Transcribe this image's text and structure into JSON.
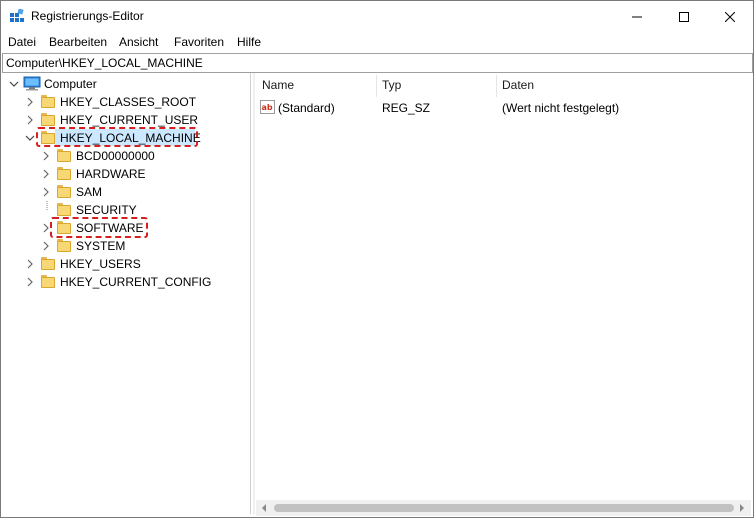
{
  "window": {
    "title": "Registrierungs-Editor",
    "controls": [
      "minimize",
      "maximize",
      "close"
    ]
  },
  "menu": [
    "Datei",
    "Bearbeiten",
    "Ansicht",
    "Favoriten",
    "Hilfe"
  ],
  "address": "Computer\\HKEY_LOCAL_MACHINE",
  "tree": {
    "root": "Computer",
    "hives": [
      "HKEY_CLASSES_ROOT",
      "HKEY_CURRENT_USER",
      "HKEY_LOCAL_MACHINE",
      "HKEY_USERS",
      "HKEY_CURRENT_CONFIG"
    ],
    "hklm_children": [
      "BCD00000000",
      "HARDWARE",
      "SAM",
      "SECURITY",
      "SOFTWARE",
      "SYSTEM"
    ],
    "selected": "HKEY_LOCAL_MACHINE",
    "highlighted": [
      "HKEY_LOCAL_MACHINE",
      "SOFTWARE"
    ]
  },
  "list": {
    "columns": [
      "Name",
      "Typ",
      "Daten"
    ],
    "rows": [
      {
        "name": "(Standard)",
        "type": "REG_SZ",
        "data": "(Wert nicht festgelegt)"
      }
    ]
  },
  "colors": {
    "selection": "#cce8ff",
    "highlight_border": "#d62020",
    "folder": "#f8d775"
  }
}
